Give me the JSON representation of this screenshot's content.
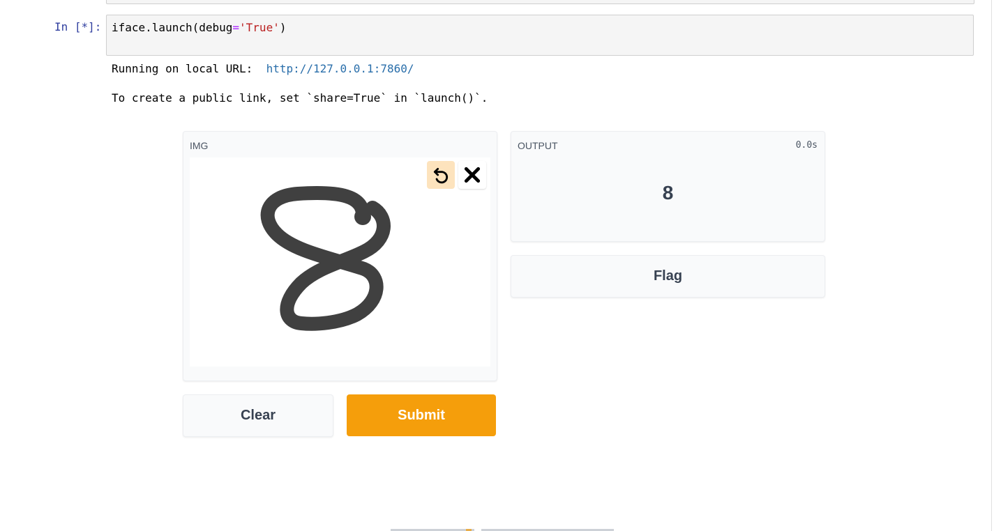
{
  "notebook": {
    "prompt": "In [*]:",
    "code": {
      "prefix": "iface.launch(debug",
      "operator": "=",
      "string": "'True'",
      "suffix": ")"
    },
    "output": {
      "line1_text": "Running on local URL:  ",
      "line1_url": "http://127.0.0.1:7860/",
      "line2": "To create a public link, set `share=True` in `launch()`."
    }
  },
  "app": {
    "input_panel": {
      "label": "IMG",
      "undo_icon": "undo-icon",
      "clear_icon": "close-icon",
      "stroke_color": "#404040"
    },
    "output_panel": {
      "label": "OUTPUT",
      "timer": "0.0s",
      "value": "8"
    },
    "flag_label": "Flag",
    "clear_label": "Clear",
    "submit_label": "Submit",
    "colors": {
      "primary": "#f59e0b",
      "undo_bg": "#fde3bd",
      "link": "#296eaa",
      "prompt": "#303f9f"
    }
  }
}
